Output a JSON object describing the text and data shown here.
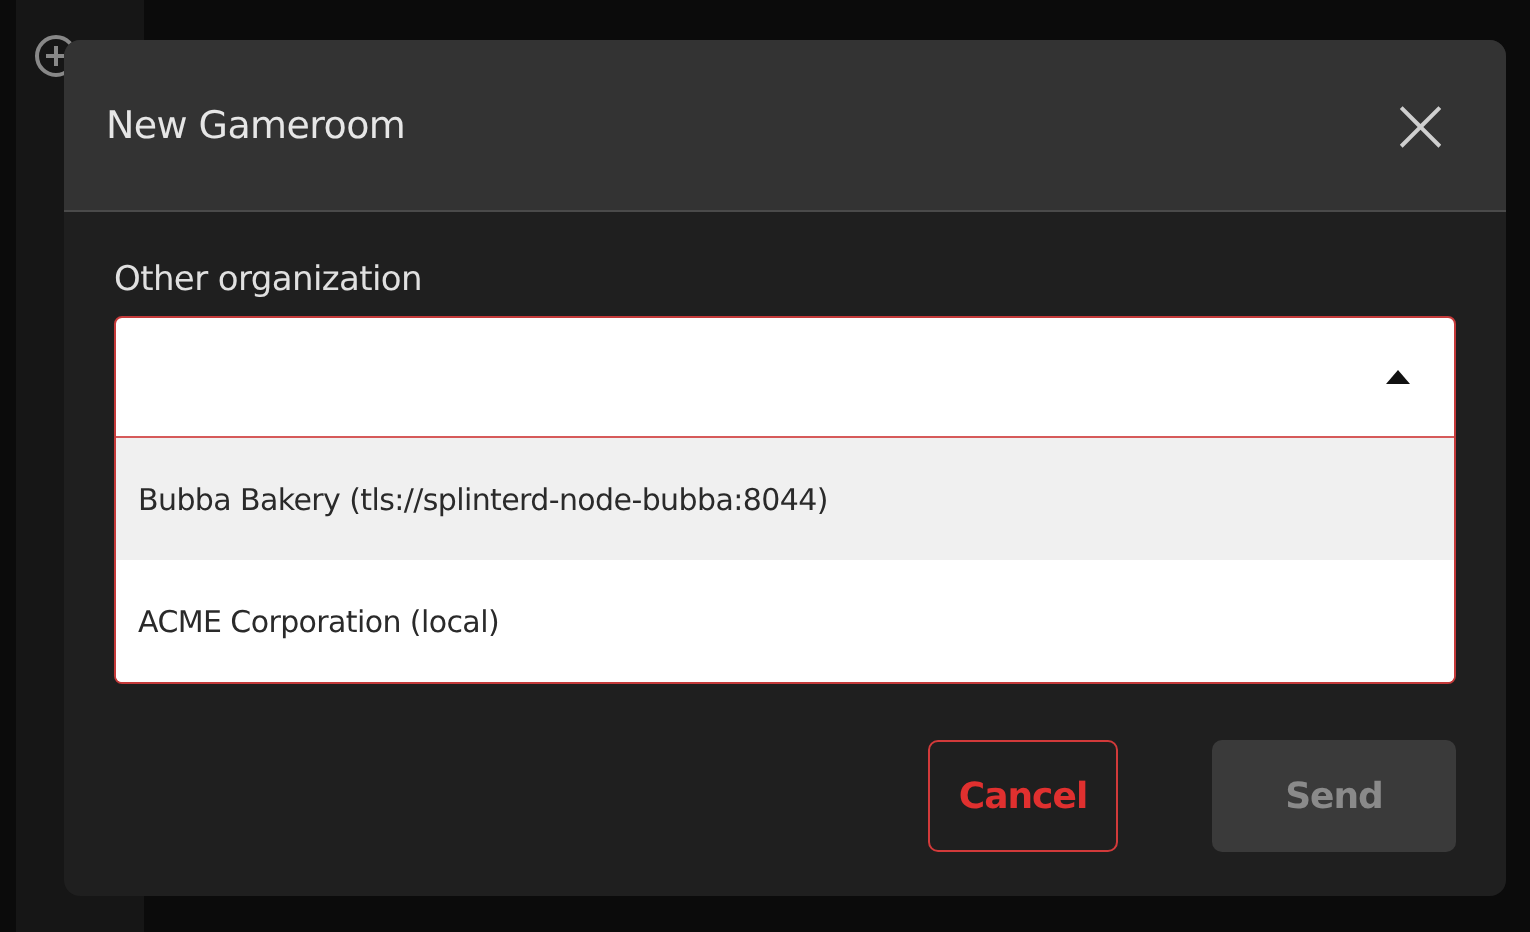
{
  "dialog": {
    "title": "New Gameroom",
    "close": "×"
  },
  "field": {
    "label": "Other organization",
    "expanded": true,
    "options": [
      {
        "label": "Bubba Bakery (tls://splinterd-node-bubba:8044)",
        "selected": true
      },
      {
        "label": "ACME Corporation (local)",
        "selected": false
      }
    ]
  },
  "buttons": [
    {
      "label": "Cancel",
      "kind": "outline",
      "disabled": false
    },
    {
      "label": "Send",
      "kind": "primary",
      "disabled": true
    }
  ]
}
